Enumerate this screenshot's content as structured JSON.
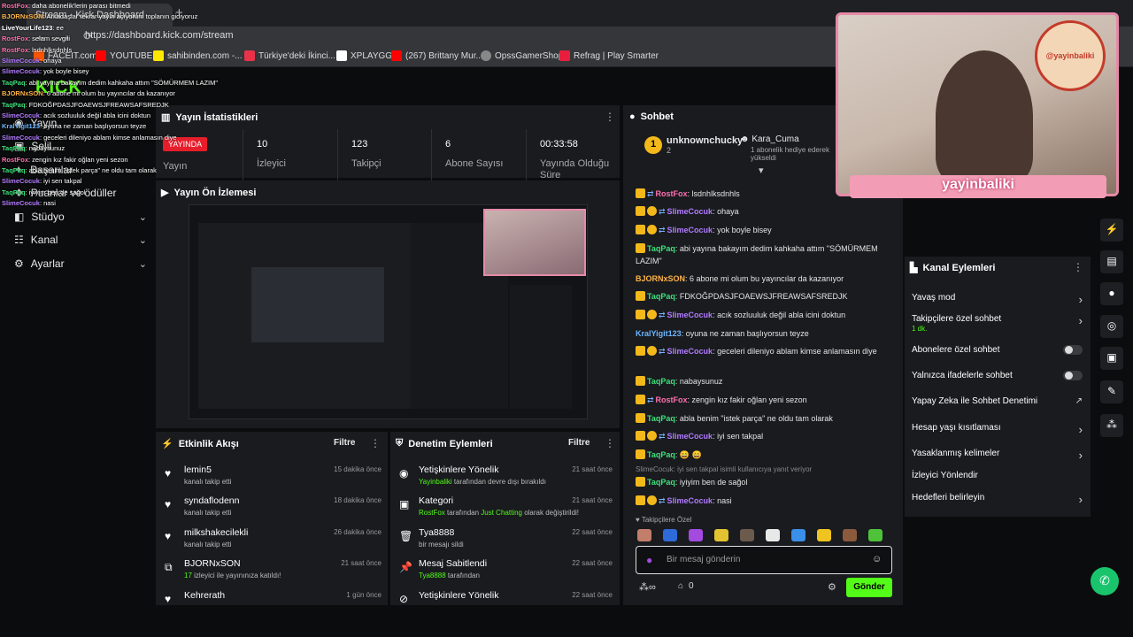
{
  "browser": {
    "tab_title": "Stream - Kick Dashboard",
    "new_tab": "+",
    "url": "https://dashboard.kick.com/stream",
    "bookmarks": [
      "FACEIT.com",
      "YOUTUBE",
      "sahibinden.com -...",
      "Türkiye'deki İkinci...",
      "XPLAYGG",
      "(267) Brittany Mur...",
      "OpssGamerShop",
      "Refrag | Play Smarter"
    ]
  },
  "sidebar": {
    "logo": "KICK",
    "items": [
      {
        "label": "Yayın"
      },
      {
        "label": "Şelil"
      },
      {
        "label": "Başarılar"
      },
      {
        "label": "Puanlar ve ödüller"
      },
      {
        "label": "Stüdyo"
      },
      {
        "label": "Kanal"
      },
      {
        "label": "Ayarlar"
      }
    ]
  },
  "overlay_chat": [
    {
      "name": "RostFox",
      "text": ": daha abonelik'lerin parası bitmedi"
    },
    {
      "name": "BJORNxSON",
      "text": ": Arkadaşlar tekrar yayın açıyorum toplanın gidiyoruz"
    },
    {
      "name": "LiveYourLife123",
      "text": ": ee"
    },
    {
      "name": "RostFox",
      "text": ": selam sevgili"
    },
    {
      "name": "RostFox",
      "text": ": lsdnhlksdnhls"
    },
    {
      "name": "SlimeCocuk",
      "text": ": ohaya"
    },
    {
      "name": "SlimeCocuk",
      "text": ": yok boyle bisey"
    },
    {
      "name": "TaqPaq",
      "text": ": abi yayına bakayım dedim kahkaha attım \"SÖMÜRMEM LAZIM\""
    },
    {
      "name": "BJORNxSON",
      "text": ": 6 abone mi olum bu yayıncılar da kazanıyor"
    },
    {
      "name": "TaqPaq",
      "text": ": FDKOĞPDASJFOAEWSJFREAWSAFSREDJK"
    },
    {
      "name": "SlimeCocuk",
      "text": ": acık sozluuluk değil abla icini doktun"
    },
    {
      "name": "KralYigit123",
      "text": ": oyuna ne zaman başlıyorsun teyze"
    },
    {
      "name": "SlimeCocuk",
      "text": ": geceleri dileniyo ablam kimse anlamasın diye"
    },
    {
      "name": "TaqPaq",
      "text": ": nabaysunuz"
    },
    {
      "name": "RostFox",
      "text": ": zengin kız fakir oğlan yeni sezon"
    },
    {
      "name": "TaqPaq",
      "text": ": abla benim \"istek parça\" ne oldu tam olarak"
    },
    {
      "name": "SlimeCocuk",
      "text": ": iyi sen takpal"
    },
    {
      "name": "TaqPaq",
      "text": ": iyiyim ben de sağol"
    },
    {
      "name": "SlimeCocuk",
      "text": ": nasi"
    }
  ],
  "stats": {
    "title": "Yayın İstatistikleri",
    "live_badge": "YAYINDA",
    "live_label": "Yayın",
    "viewers": {
      "value": "10",
      "label": "İzleyici"
    },
    "followers": {
      "value": "123",
      "label": "Takipçi"
    },
    "subs": {
      "value": "6",
      "label": "Abone Sayısı"
    },
    "uptime": {
      "value": "00:33:58",
      "label": "Yayında Olduğu Süre"
    }
  },
  "preview": {
    "title": "Yayın Ön İzlemesi"
  },
  "feed": {
    "title": "Etkinlik Akışı",
    "filter": "Filtre",
    "items": [
      {
        "name": "lemin5",
        "sub": "kanalı takip etti",
        "time": "15 dakika önce",
        "icon": "heart-icon"
      },
      {
        "name": "syndaflodenn",
        "sub": "kanalı takip etti",
        "time": "18 dakika önce",
        "icon": "heart-icon"
      },
      {
        "name": "milkshakecilekli",
        "sub": "kanalı takip etti",
        "time": "26 dakika önce",
        "icon": "heart-icon"
      },
      {
        "name": "BJORNxSON",
        "sub_num": "17",
        "sub": " izleyici ile yayınınıza katıldı!",
        "time": "21 saat önce",
        "icon": "raid-icon"
      },
      {
        "name": "Kehrerath",
        "sub": "",
        "time": "1 gün önce",
        "icon": "heart-icon"
      }
    ]
  },
  "mod": {
    "title": "Denetim Eylemleri",
    "filter": "Filtre",
    "items": [
      {
        "name": "Yetişkinlere Yönelik",
        "actor": "Yayinbaliki",
        "sub": " tarafından devre dışı bırakıldı",
        "time": "21 saat önce"
      },
      {
        "name": "Kategori",
        "actor": "RostFox",
        "sub": " tarafından ",
        "extra": "Just Chatting",
        "sub2": " olarak değiştirildi!",
        "time": "21 saat önce"
      },
      {
        "name": "Tya8888",
        "sub": "bir mesajı sildi",
        "time": "22 saat önce"
      },
      {
        "name": "Mesaj Sabitlendi",
        "actor": "Tya8888",
        "sub": " tarafından",
        "time": "22 saat önce"
      },
      {
        "name": "Yetişkinlere Yönelik",
        "time": "22 saat önce"
      }
    ]
  },
  "chat": {
    "title": "Sohbet",
    "top_gifter": {
      "name": "unknownchucky",
      "count": "2"
    },
    "gift_user": {
      "name": "Kara_Cuma",
      "text": "1 abonelik hediye ederek yükseldi"
    },
    "messages": [
      {
        "user": "RostFox",
        "text": ": lsdnhlksdnhls",
        "color": "pink"
      },
      {
        "user": "SlimeCocuk",
        "text": ": ohaya",
        "color": "purple"
      },
      {
        "user": "SlimeCocuk",
        "text": ": yok boyle bisey",
        "color": "purple"
      },
      {
        "user": "TaqPaq",
        "text": ": abi yayına bakayım dedim kahkaha attım \"SÖMÜRMEM LAZIM\"",
        "color": "green"
      },
      {
        "user": "BJORNxSON",
        "text": ": 6 abone mi olum bu yayıncılar da kazanıyor",
        "color": "orange"
      },
      {
        "user": "TaqPaq",
        "text": ": FDKOĞPDASJFOAEWSJFREAWSAFSREDJK",
        "color": "green"
      },
      {
        "user": "SlimeCocuk",
        "text": ": acık sozluuluk değil abla icini doktun",
        "color": "purple"
      },
      {
        "user": "KralYigit123",
        "text": ": oyuna ne zaman başlıyorsun teyze",
        "color": "blue"
      },
      {
        "user": "SlimeCocuk",
        "text": ": geceleri dileniyo ablam kimse anlamasın diye",
        "color": "purple"
      },
      {
        "user": "TaqPaq",
        "text": ": nabaysunuz",
        "color": "green"
      },
      {
        "user": "RostFox",
        "text": ": zengin kız fakir oğlan yeni sezon",
        "color": "pink"
      },
      {
        "user": "TaqPaq",
        "text": ": abla benim \"istek parça\" ne oldu tam olarak",
        "color": "green"
      },
      {
        "user": "SlimeCocuk",
        "text": ": iyi sen takpal",
        "color": "purple"
      },
      {
        "user": "TaqPaq",
        "text": ": 😄 😄",
        "color": "green"
      },
      {
        "user": "TaqPaq",
        "text": ": iyiyim ben de sağol",
        "color": "green"
      },
      {
        "user": "SlimeCocuk",
        "text": ": nasi",
        "color": "purple"
      }
    ],
    "reply_hint": "SlimeCocuk: iyi sen takpal isimli kullanıcıya yanıt veriyor",
    "emote_label": "Takipçilere Özel",
    "input_placeholder": "Bir mesaj gönderin",
    "points": "0",
    "send": "Gönder"
  },
  "actions": {
    "title": "Kanal Eylemleri",
    "items": [
      {
        "label": "Yavaş mod",
        "kind": "chevron"
      },
      {
        "label": "Takipçilere özel sohbet",
        "sub": "1 dk.",
        "kind": "chevron"
      },
      {
        "label": "Abonelere özel sohbet",
        "kind": "toggle"
      },
      {
        "label": "Yalnızca ifadelerle sohbet",
        "kind": "toggle"
      },
      {
        "label": "Yapay Zeka ile Sohbet Denetimi",
        "kind": "external"
      },
      {
        "label": "Hesap yaşı kısıtlaması",
        "kind": "chevron"
      },
      {
        "label": "Yasaklanmış kelimeler",
        "kind": "chevron"
      },
      {
        "label": "İzleyici Yönlendir",
        "kind": "none"
      },
      {
        "label": "Hedefleri belirleyin",
        "kind": "chevron"
      }
    ]
  },
  "webcam": {
    "banner": "yayinbaliki",
    "logo_text": "@yayinbaliki"
  }
}
